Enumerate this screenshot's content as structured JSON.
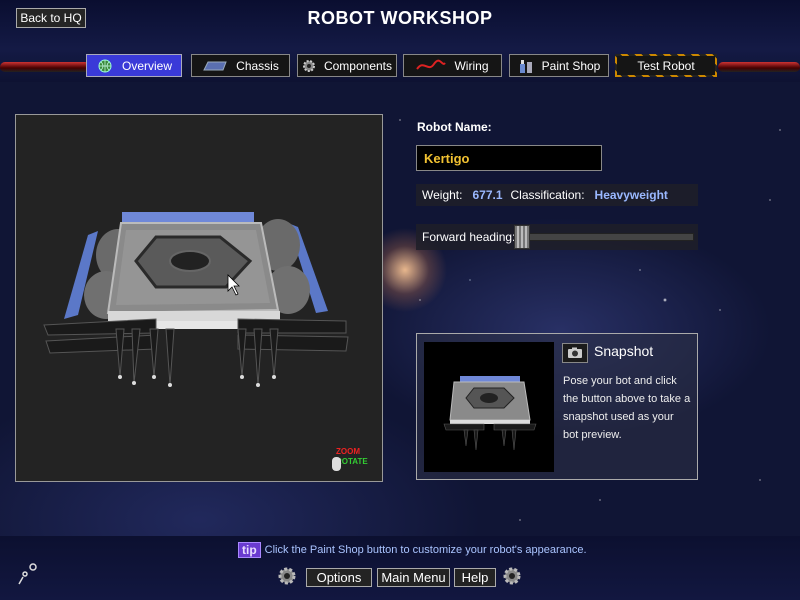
{
  "header": {
    "title": "ROBOT WORKSHOP",
    "back_label": "Back to HQ"
  },
  "tabs": [
    {
      "label": "Overview",
      "icon": "globe-icon",
      "active": true
    },
    {
      "label": "Chassis",
      "icon": "chassis-icon",
      "active": false
    },
    {
      "label": "Components",
      "icon": "gear-icon",
      "active": false
    },
    {
      "label": "Wiring",
      "icon": "wire-icon",
      "active": false
    },
    {
      "label": "Paint Shop",
      "icon": "paint-icon",
      "active": false
    },
    {
      "label": "Test Robot",
      "icon": "",
      "active": false
    }
  ],
  "viewport": {
    "zoom_label": "ZOOM",
    "rotate_label": "ROTATE"
  },
  "robot": {
    "name_label": "Robot Name:",
    "name": "Kertigo",
    "weight_label": "Weight:",
    "weight": "677.1",
    "class_label": "Classification:",
    "classification": "Heavyweight",
    "heading_label": "Forward heading:",
    "heading_fraction": 0.0
  },
  "snapshot": {
    "title": "Snapshot",
    "description": "Pose your bot and click the button above to take a snapshot used as your bot preview."
  },
  "footer": {
    "tip_badge": "tip",
    "tip_text": "Click the Paint Shop button to customize your robot's appearance.",
    "options_label": "Options",
    "main_menu_label": "Main Menu",
    "help_label": "Help"
  },
  "colors": {
    "active_tab": "#3a3ad8",
    "robot_name": "#f2c232",
    "stat_value": "#9ab8ff",
    "tip_text": "#aac4ff"
  }
}
